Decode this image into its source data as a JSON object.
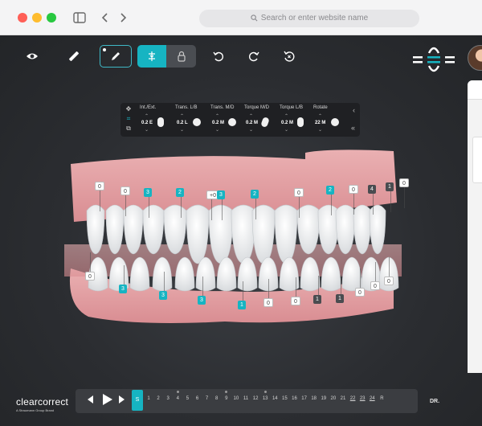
{
  "browser": {
    "address_placeholder": "Search or enter website name"
  },
  "toolbar": {
    "tools": [
      "visibility-eye",
      "ruler",
      "pen",
      "attachments",
      "lock",
      "undo",
      "redo",
      "reset"
    ],
    "active_tool": "pen",
    "active_group_tool": "attachments"
  },
  "adjustment": {
    "controls": [
      {
        "label": "Int./Ext.",
        "value": "0.2 E"
      },
      {
        "label": "Trans. L/B",
        "value": "0.2 L"
      },
      {
        "label": "Trans. M/D",
        "value": "0.2 M"
      },
      {
        "label": "Torque M/D",
        "value": "0.2 M"
      },
      {
        "label": "Torque L/B",
        "value": "0.2 M"
      },
      {
        "label": "Rotate",
        "value": "22 M"
      }
    ],
    "close_symbol": "‹",
    "collapse_symbol": "«"
  },
  "upper_tags": [
    {
      "text": "0",
      "style": "w"
    },
    {
      "text": "0",
      "style": "w"
    },
    {
      "text": "3",
      "style": "t"
    },
    {
      "text": "2",
      "style": "t"
    },
    {
      "text": "+0",
      "style": "w"
    },
    {
      "text": "3",
      "style": "t"
    },
    {
      "text": "2",
      "style": "t"
    },
    {
      "text": "0",
      "style": "w"
    },
    {
      "text": "2",
      "style": "t"
    },
    {
      "text": "0",
      "style": "w"
    },
    {
      "text": "4",
      "style": "g"
    },
    {
      "text": "1",
      "style": "g"
    },
    {
      "text": "0",
      "style": "w"
    }
  ],
  "lower_tags": [
    {
      "text": "0",
      "style": "w"
    },
    {
      "text": "3",
      "style": "t"
    },
    {
      "text": "3",
      "style": "t"
    },
    {
      "text": "3",
      "style": "t"
    },
    {
      "text": "1",
      "style": "t"
    },
    {
      "text": "0",
      "style": "w"
    },
    {
      "text": "0",
      "style": "w"
    },
    {
      "text": "1",
      "style": "g"
    },
    {
      "text": "1",
      "style": "g"
    },
    {
      "text": "0",
      "style": "w"
    },
    {
      "text": "0",
      "style": "w"
    },
    {
      "text": "0",
      "style": "w"
    }
  ],
  "timeline": {
    "brand": "clearcorrect",
    "brand_sub": "A Straumann Group Brand",
    "current_step": "S",
    "steps": [
      "1",
      "2",
      "3",
      "4",
      "5",
      "6",
      "7",
      "8",
      "9",
      "10",
      "11",
      "12",
      "13",
      "14",
      "15",
      "16",
      "17",
      "18",
      "19",
      "20",
      "21",
      "22",
      "23",
      "24",
      "R"
    ],
    "underlined_steps": [
      "22",
      "23",
      "24"
    ],
    "marked_steps": [
      "4",
      "9",
      "13"
    ],
    "doctor_label": "DR."
  },
  "colors": {
    "accent": "#16b4c2",
    "gum": "#e7a3a6",
    "canvas": "#2b2d31"
  }
}
